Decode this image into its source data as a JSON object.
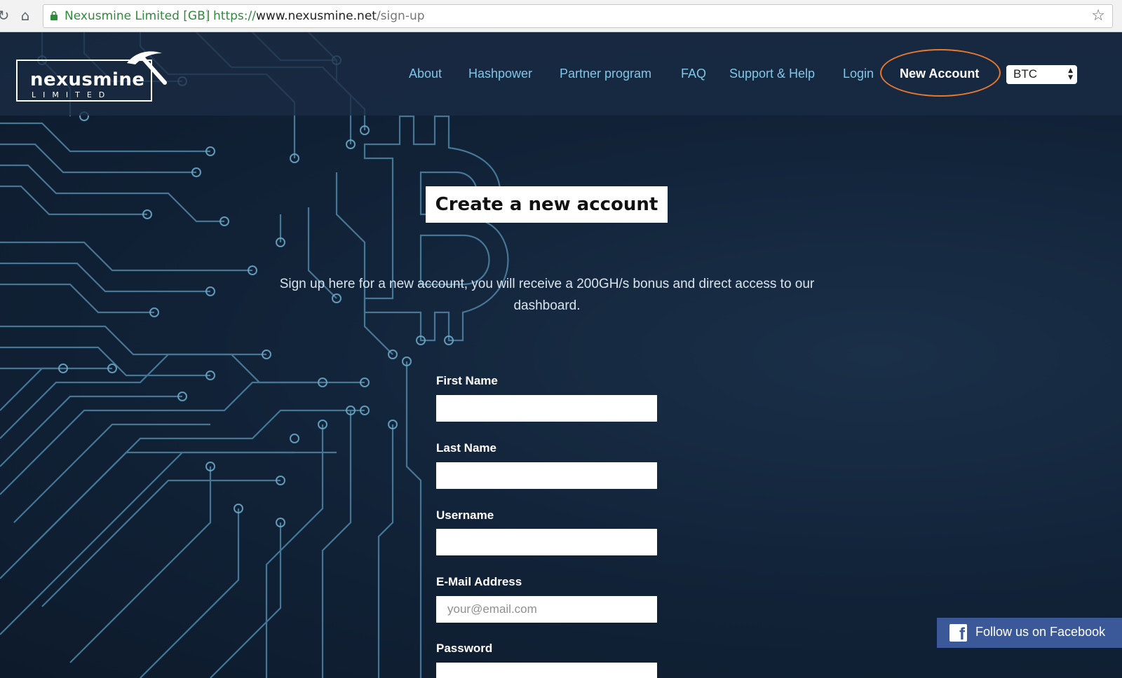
{
  "browser": {
    "site_identity": "Nexusmine Limited [GB]",
    "url_scheme": "https://",
    "url_host": "www.nexusmine.net",
    "url_path": "/sign-up"
  },
  "logo": {
    "name": "nexusmine",
    "sub": "LIMITED"
  },
  "nav": {
    "items": [
      {
        "label": "About"
      },
      {
        "label": "Hashpower"
      },
      {
        "label": "Partner program"
      },
      {
        "label": "FAQ"
      },
      {
        "label": "Support & Help"
      },
      {
        "label": "Login"
      },
      {
        "label": "New Account"
      }
    ],
    "currency": "BTC",
    "highlight_color": "#e9782c"
  },
  "main": {
    "title": "Create a new account",
    "intro": "Sign up here for a new account, you will receive a 200GH/s bonus and direct access to our dashboard."
  },
  "form": {
    "first_name_label": "First Name",
    "last_name_label": "Last Name",
    "username_label": "Username",
    "email_label": "E-Mail Address",
    "email_placeholder": "your@email.com",
    "password_label": "Password"
  },
  "social": {
    "follow_label": "Follow us on Facebook"
  },
  "colors": {
    "background": "#12243a",
    "nav_link": "#7fc6e8",
    "facebook": "#3b5998"
  }
}
